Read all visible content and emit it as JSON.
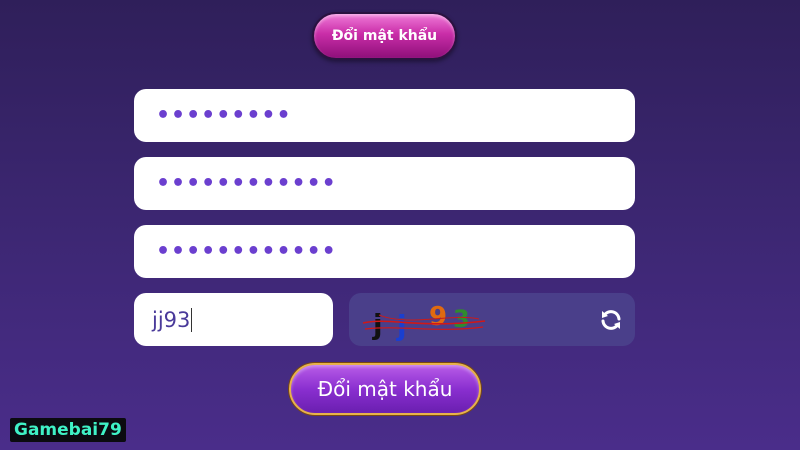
{
  "header": {
    "tab_label": "Đổi mật khẩu"
  },
  "form": {
    "current_password_mask": "•••••••••",
    "new_password_mask": "••••••••••••",
    "confirm_password_mask": "••••••••••••",
    "captcha_input_value": "jj93",
    "captcha_image_text": "jj93",
    "submit_label": "Đổi mật khẩu"
  },
  "icons": {
    "refresh": "refresh-icon"
  },
  "watermark": {
    "text": "Gamebai79"
  },
  "colors": {
    "accent_purple": "#6b3fcf",
    "tab_pink": "#c92ea8",
    "submit_purple": "#8a2fd0",
    "submit_border_gold": "#e8b24a",
    "captcha_bg": "#4a3f8a",
    "watermark_text": "#3ff2c6"
  }
}
